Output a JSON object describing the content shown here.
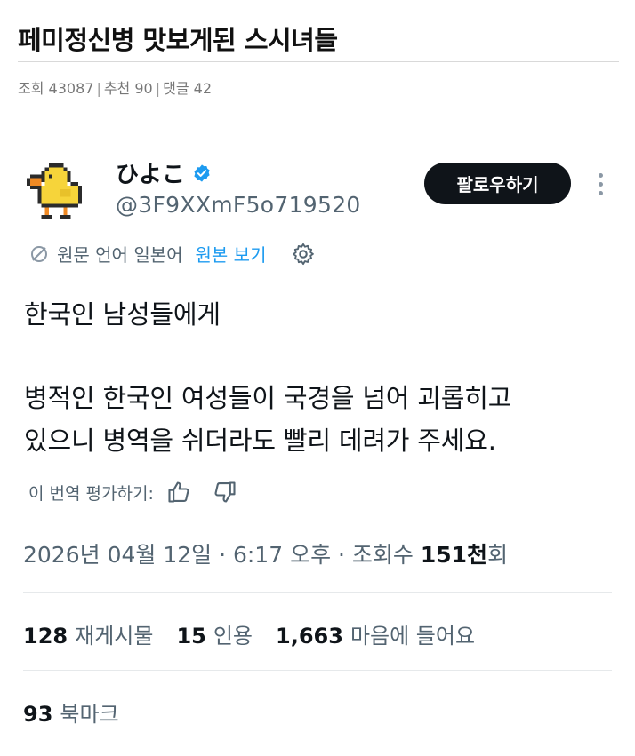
{
  "post": {
    "title": "페미정신병 맛보게된 스시녀들",
    "meta": {
      "views_label": "조회 43087",
      "recommend_label": "추천 90",
      "comments_label": "댓글 42"
    }
  },
  "tweet": {
    "display_name": "ひよこ",
    "handle": "@3F9XXmF5o719520",
    "follow_label": "팔로우하기",
    "translation": {
      "source_label": "원문 언어 일본어",
      "show_original_label": "원본 보기"
    },
    "text_lines": [
      "한국인 남성들에게",
      "병적인 한국인 여성들이 국경을 넘어 괴롭히고",
      "있으니 병역을 쉬더라도 빨리 데려가 주세요."
    ],
    "rate_label": "이 번역 평가하기:",
    "timestamp": "2026년 04월 12일 · 6:17 오후 · 조회수",
    "views_value": "151천",
    "views_suffix": "회",
    "stats": {
      "retweets_count": "128",
      "retweets_label": "재게시물",
      "quotes_count": "15",
      "quotes_label": "인용",
      "likes_count": "1,663",
      "likes_label": "마음에 들어요",
      "bookmarks_count": "93",
      "bookmarks_label": "북마크"
    }
  },
  "colors": {
    "accent": "#1d9bf0",
    "text": "#0f1419",
    "secondary": "#536471",
    "follow_bg": "#0f1419",
    "avatar_yellow": "#f6d43a"
  },
  "icons": [
    "chick-avatar",
    "verified-badge-icon",
    "translate-icon",
    "gear-icon",
    "thumbs-up-icon",
    "thumbs-down-icon",
    "more-dots-icon"
  ]
}
